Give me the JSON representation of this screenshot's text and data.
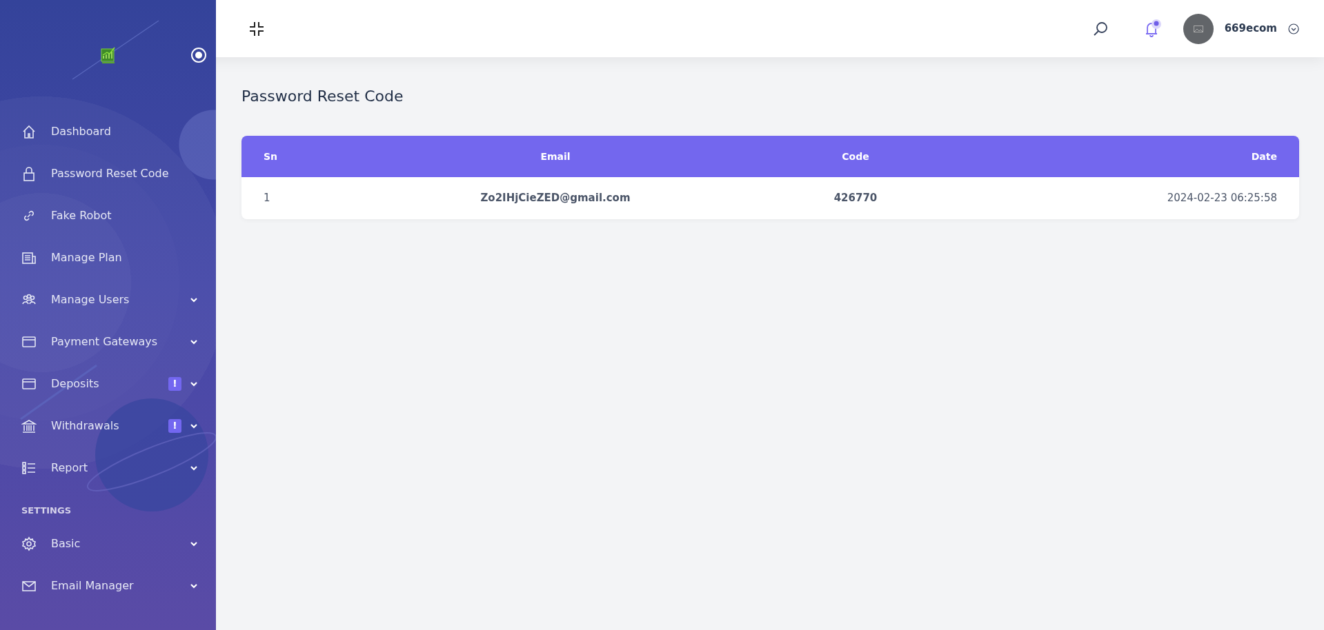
{
  "sidebar": {
    "items": [
      {
        "kind": "link",
        "label": "Dashboard",
        "has_submenu": false
      },
      {
        "kind": "link",
        "label": "Password Reset Code",
        "has_submenu": false
      },
      {
        "kind": "link",
        "label": "Fake Robot",
        "has_submenu": false
      },
      {
        "kind": "link",
        "label": "Manage Plan",
        "has_submenu": false
      },
      {
        "kind": "link",
        "label": "Manage Users",
        "has_submenu": true
      },
      {
        "kind": "link",
        "label": "Payment Gateways",
        "has_submenu": true
      },
      {
        "kind": "link",
        "label": "Deposits",
        "has_submenu": true,
        "badge": "!"
      },
      {
        "kind": "link",
        "label": "Withdrawals",
        "has_submenu": true,
        "badge": "!"
      },
      {
        "kind": "link",
        "label": "Report",
        "has_submenu": true
      },
      {
        "kind": "heading",
        "label": "SETTINGS"
      },
      {
        "kind": "link",
        "label": "Basic",
        "has_submenu": true
      },
      {
        "kind": "link",
        "label": "Email Manager",
        "has_submenu": true
      }
    ]
  },
  "header": {
    "user": "669ecom",
    "notification_unread": true
  },
  "page_title": "Password Reset Code",
  "table": {
    "columns": [
      "Sn",
      "Email",
      "Code",
      "Date"
    ],
    "rows": [
      [
        "1",
        "Zo2IHjCieZED@gmail.com",
        "426770",
        "2024-02-23 06:25:58"
      ]
    ]
  }
}
